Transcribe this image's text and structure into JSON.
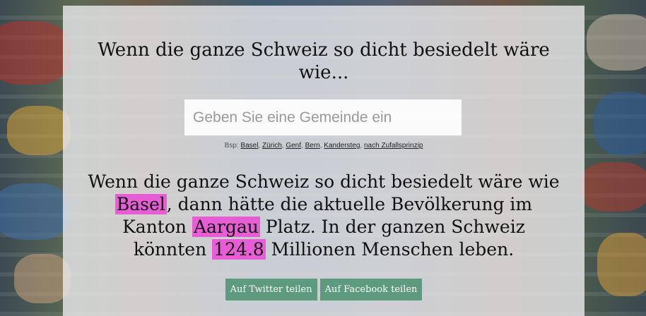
{
  "colors": {
    "highlight": "#e85cd6",
    "share_button": "#5d9a7e",
    "panel_background": "#ebebed"
  },
  "header": {
    "title": "Wenn die ganze Schweiz so dicht besiedelt wäre wie..."
  },
  "search": {
    "placeholder": "Geben Sie eine Gemeinde ein",
    "value": ""
  },
  "examples": {
    "prefix": "Bsp:",
    "links": [
      "Basel",
      "Zürich",
      "Genf",
      "Bern",
      "Kandersteg",
      "nach Zufallsprinzip"
    ]
  },
  "result": {
    "part1": "Wenn die ganze Schweiz so dicht besiedelt wäre wie ",
    "municipality": "Basel",
    "part2": ", dann hätte die aktuelle Bevölkerung im Kanton ",
    "canton": "Aargau",
    "part3": " Platz. In der ganzen Schweiz könnten ",
    "population": "124.8",
    "part4": " Millionen Menschen leben."
  },
  "share": {
    "twitter_label": "Auf Twitter teilen",
    "facebook_label": "Auf Facebook teilen"
  }
}
